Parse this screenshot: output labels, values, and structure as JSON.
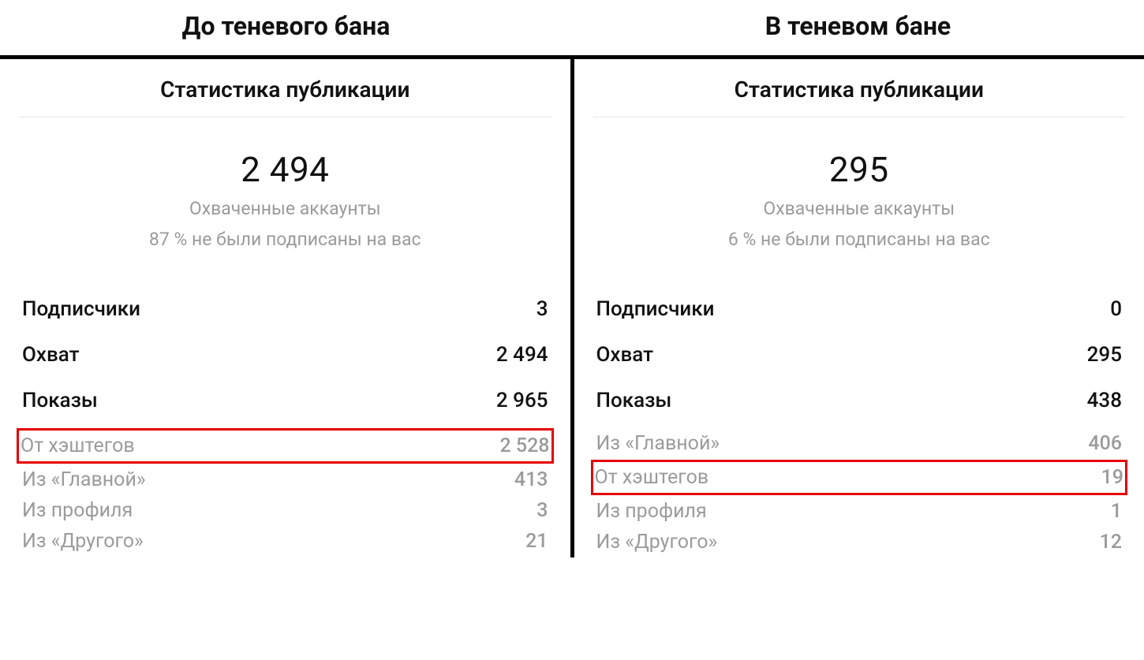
{
  "headings": {
    "before": "До теневого бана",
    "during": "В теневом бане"
  },
  "stats_title": "Статистика публикации",
  "reach_label": "Охваченные аккаунты",
  "left": {
    "big_number": "2 494",
    "non_followers_line": "87 % не были подписаны на вас",
    "rows_primary": [
      {
        "label": "Подписчики",
        "value": "3"
      },
      {
        "label": "Охват",
        "value": "2 494"
      },
      {
        "label": "Показы",
        "value": "2 965"
      }
    ],
    "rows_secondary": [
      {
        "label": "От хэштегов",
        "value": "2 528",
        "highlight": true
      },
      {
        "label": "Из «Главной»",
        "value": "413"
      },
      {
        "label": "Из профиля",
        "value": "3"
      },
      {
        "label": "Из «Другого»",
        "value": "21"
      }
    ]
  },
  "right": {
    "big_number": "295",
    "non_followers_line": "6 % не были подписаны на вас",
    "rows_primary": [
      {
        "label": "Подписчики",
        "value": "0"
      },
      {
        "label": "Охват",
        "value": "295"
      },
      {
        "label": "Показы",
        "value": "438"
      }
    ],
    "rows_secondary": [
      {
        "label": "Из «Главной»",
        "value": "406"
      },
      {
        "label": "От хэштегов",
        "value": "19",
        "highlight": true
      },
      {
        "label": "Из профиля",
        "value": "1"
      },
      {
        "label": "Из «Другого»",
        "value": "12"
      }
    ]
  }
}
